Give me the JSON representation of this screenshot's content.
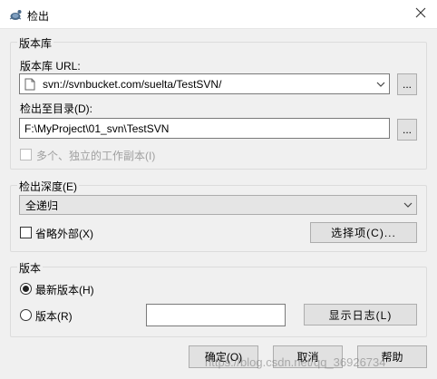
{
  "window": {
    "title": "检出",
    "close_icon": "close-icon",
    "app_icon": "tortoisesvn-icon"
  },
  "repo_group": {
    "label": "版本库",
    "url_label": "版本库 URL:",
    "url_value": "svn://svnbucket.com/suelta/TestSVN/",
    "browse_label": "...",
    "checkout_dir_label": "检出至目录(D):",
    "checkout_dir_value": "F:\\MyProject\\01_svn\\TestSVN",
    "dir_browse_label": "...",
    "independent_copies_label": "多个、独立的工作副本(I)"
  },
  "depth_group": {
    "label": "检出深度(E)",
    "depth_value": "全递归",
    "omit_externals_label": "省略外部(X)",
    "options_button_label": "选择项(C)..."
  },
  "revision_group": {
    "label": "版本",
    "head_label": "最新版本(H)",
    "revision_label": "版本(R)",
    "revision_value": "",
    "show_log_label": "显示日志(L)"
  },
  "footer": {
    "ok_label": "确定(O)",
    "cancel_label": "取消",
    "help_label": "帮助"
  },
  "watermark": "https://blog.csdn.net/qq_36926734",
  "colors": {
    "window_bg": "#f0f0f0",
    "border": "#adadad"
  }
}
